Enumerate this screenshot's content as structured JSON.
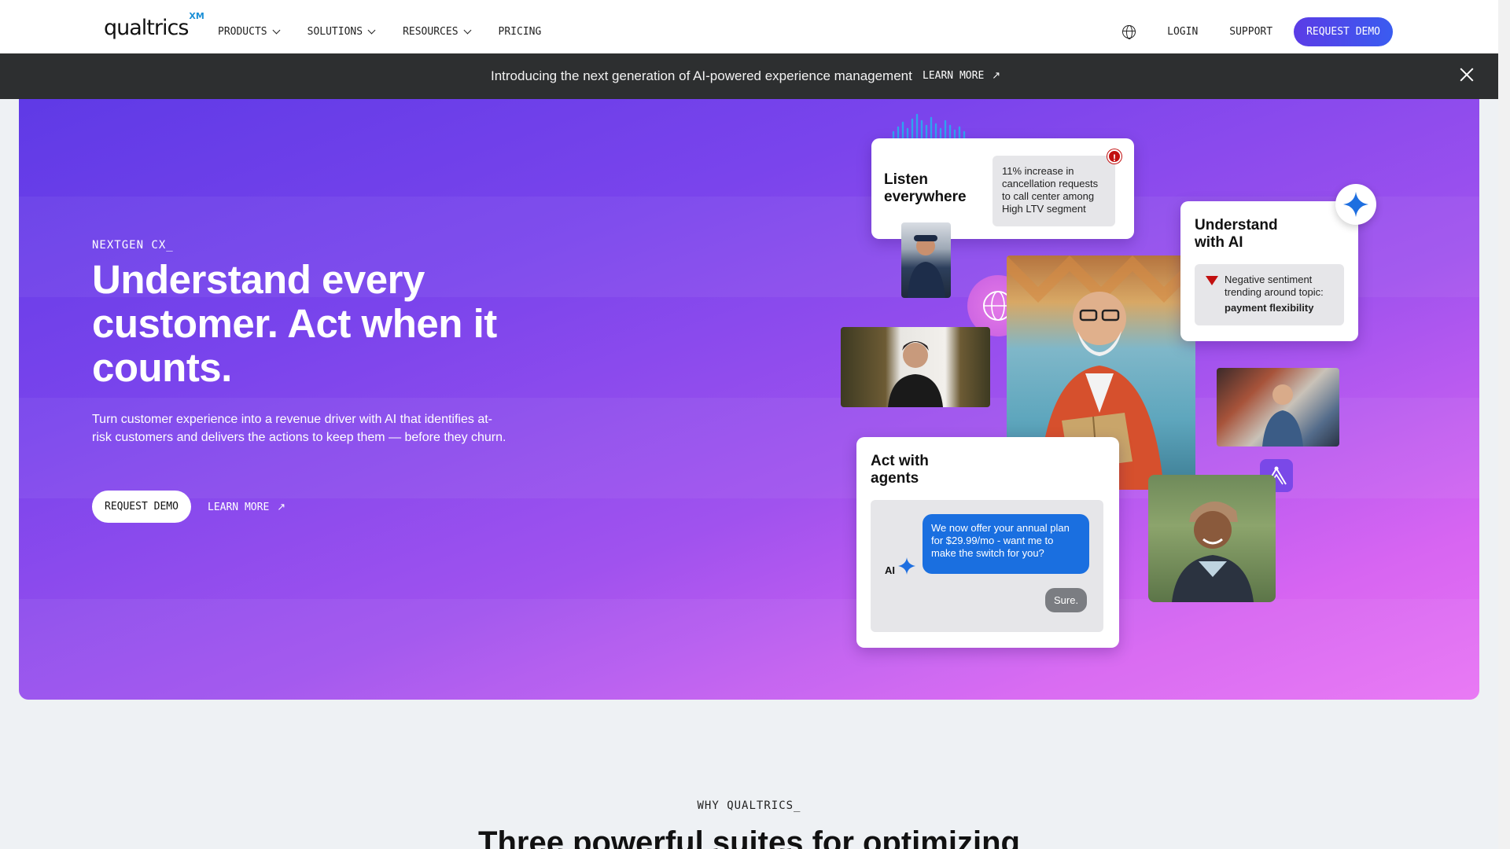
{
  "nav": {
    "logo": "qualtrics",
    "logo_sup": "XM",
    "menu": [
      {
        "label": "PRODUCTS"
      },
      {
        "label": "SOLUTIONS"
      },
      {
        "label": "RESOURCES"
      },
      {
        "label": "PRICING"
      }
    ],
    "login": "LOGIN",
    "support": "SUPPORT",
    "request_demo": "REQUEST DEMO"
  },
  "banner": {
    "text": "Introducing the next generation of AI-powered experience management",
    "link": "LEARN MORE"
  },
  "hero": {
    "eyebrow": "NEXTGEN CX_",
    "title": "Understand every customer. Act when it counts.",
    "subtitle": "Turn customer experience into a revenue driver with AI that identifies at-risk customers and delivers the actions to keep them — before they churn.",
    "request_demo": "REQUEST DEMO",
    "learn_more": "LEARN MORE"
  },
  "collage": {
    "listen": {
      "title": "Listen everywhere",
      "note": "11% increase in cancellation requests to call center among High LTV segment",
      "alert": "!"
    },
    "understand": {
      "title": "Understand with AI",
      "note": "Negative sentiment trending around topic:",
      "topic": "payment flexibility"
    },
    "act": {
      "title": "Act with agents",
      "ai_label": "AI",
      "message": "We now offer your annual plan for $29.99/mo - want me to make the switch for you?",
      "reply": "Sure."
    }
  },
  "below": {
    "eyebrow": "WHY QUALTRICS_",
    "heading": "Three powerful suites for optimizing"
  },
  "colors": {
    "accent": "#5b3ce6",
    "banner_bg": "#2d2f30",
    "chat_blue": "#1a6fe0",
    "alert": "#c21010"
  }
}
